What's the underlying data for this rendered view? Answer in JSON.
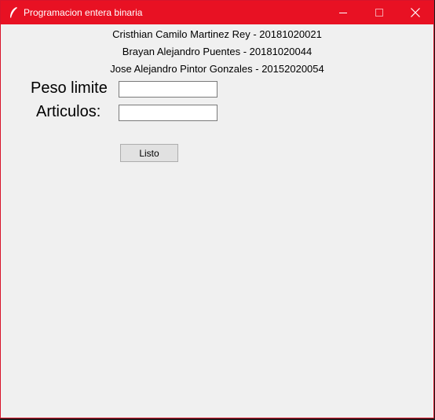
{
  "window": {
    "title": "Programacion entera binaria",
    "app_icon": "feather-icon",
    "controls": {
      "minimize": "minimize-icon",
      "maximize": "maximize-icon",
      "close": "close-icon"
    }
  },
  "authors": [
    "Cristhian Camilo Martinez Rey - 20181020021",
    "Brayan Alejandro Puentes - 20181020044",
    "Jose Alejandro Pintor Gonzales - 20152020054"
  ],
  "form": {
    "peso_label": "Peso limite",
    "peso_value": "",
    "articulos_label": "Articulos:",
    "articulos_value": "",
    "submit_label": "Listo"
  },
  "colors": {
    "titlebar": "#e81123",
    "background": "#f0f0f0"
  }
}
